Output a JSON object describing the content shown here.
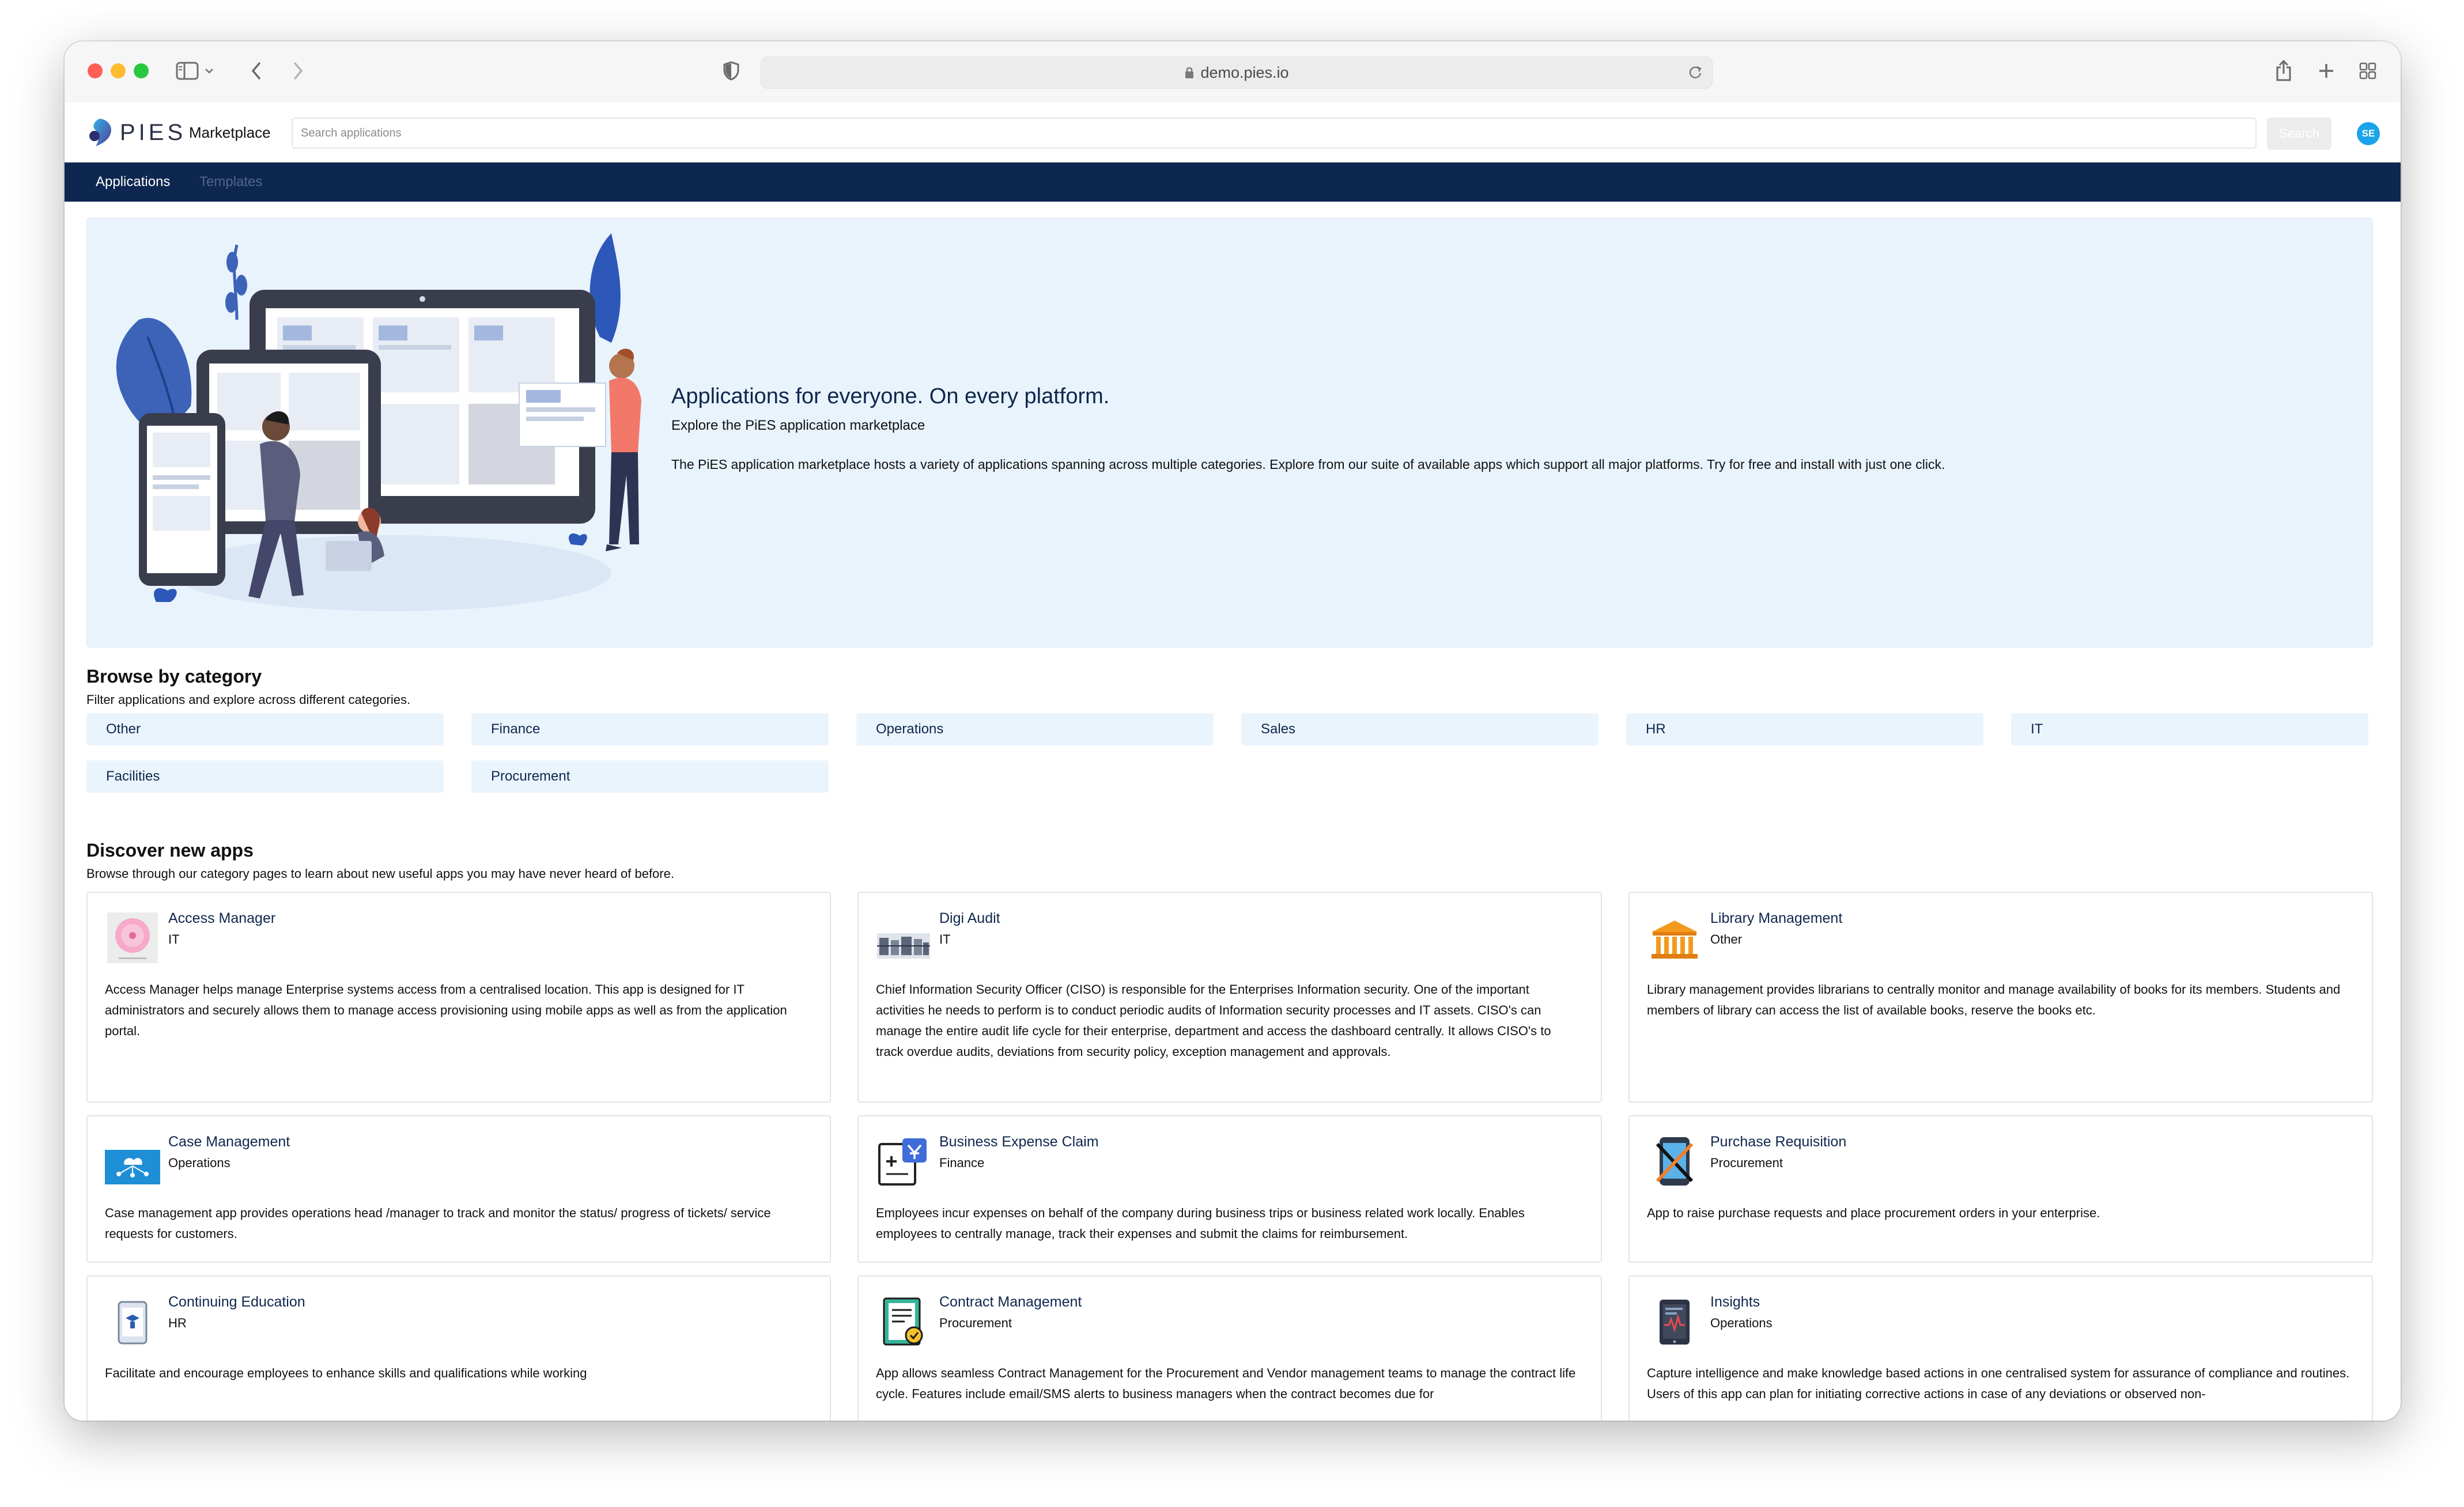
{
  "browser": {
    "url": "demo.pies.io",
    "icons": [
      "sidebar-icon",
      "chevron-down-icon",
      "back-icon",
      "forward-icon",
      "shield-icon",
      "lock-icon",
      "reload-icon",
      "share-icon",
      "new-tab-icon",
      "tab-overview-icon"
    ]
  },
  "header": {
    "logo_text": "PIES",
    "title": "Marketplace",
    "search_placeholder": "Search applications",
    "search_button": "Search",
    "avatar_initials": "SE"
  },
  "nav": {
    "tabs": [
      {
        "label": "Applications",
        "active": true
      },
      {
        "label": "Templates",
        "active": false
      }
    ]
  },
  "hero": {
    "title": "Applications for everyone. On every platform.",
    "subtitle": "Explore the PiES application marketplace",
    "description": "The PiES application marketplace hosts a variety of applications spanning across multiple categories. Explore from our suite of available apps which support all major platforms. Try for free and install with just one click."
  },
  "browse": {
    "title": "Browse by category",
    "subtitle": "Filter applications and explore across different categories.",
    "categories": [
      "Other",
      "Finance",
      "Operations",
      "Sales",
      "HR",
      "IT",
      "Facilities",
      "Procurement"
    ]
  },
  "discover": {
    "title": "Discover new apps",
    "subtitle": "Browse through our category pages to learn about new useful apps you may have never heard of before.",
    "apps": [
      {
        "name": "Access Manager",
        "category": "IT",
        "icon": "access-manager-icon",
        "description": "Access Manager helps manage Enterprise systems access from a centralised location. This app is designed for IT administrators and securely allows them to manage access provisioning using mobile apps as well as from the application portal."
      },
      {
        "name": "Digi Audit",
        "category": "IT",
        "icon": "digi-audit-icon",
        "description": "Chief Information Security Officer (CISO) is responsible for the Enterprises Information security. One of the important activities he needs to perform is to conduct periodic audits of Information security processes and IT assets. CISO's can manage the entire audit life cycle for their enterprise, department and access the dashboard centrally. It allows CISO's to track overdue audits, deviations from security policy, exception management and approvals."
      },
      {
        "name": "Library Management",
        "category": "Other",
        "icon": "library-building-icon",
        "description": "Library management provides librarians to centrally monitor and manage availability of books for its members. Students and members of library can access the list of available books, reserve the books etc."
      },
      {
        "name": "Case Management",
        "category": "Operations",
        "icon": "case-management-icon",
        "description": "Case management app provides operations head /manager to track and monitor the status/ progress of tickets/ service requests for customers."
      },
      {
        "name": "Business Expense Claim",
        "category": "Finance",
        "icon": "expense-claim-icon",
        "description": "Employees incur expenses on behalf of the company during business trips or business related work locally. Enables employees to centrally manage, track their expenses and submit the claims for reimbursement."
      },
      {
        "name": "Purchase Requisition",
        "category": "Procurement",
        "icon": "purchase-requisition-icon",
        "description": "App to raise purchase requests and place procurement orders in your enterprise."
      },
      {
        "name": "Continuing Education",
        "category": "HR",
        "icon": "continuing-education-icon",
        "description": "Facilitate and encourage employees to enhance skills and qualifications while working"
      },
      {
        "name": "Contract Management",
        "category": "Procurement",
        "icon": "contract-document-icon",
        "description": "App allows seamless Contract Management for the Procurement and Vendor management teams to manage the contract life cycle. Features include email/SMS alerts to business managers when the contract becomes due for"
      },
      {
        "name": "Insights",
        "category": "Operations",
        "icon": "insights-tablet-icon",
        "description": "Capture intelligence and make knowledge based actions in one centralised system for assurance of compliance and routines. Users of this app can plan for initiating corrective actions in case of any deviations or observed non-"
      }
    ]
  },
  "colors": {
    "navbar": "#0d2751",
    "hero_bg": "#e9f3fc",
    "category_bg": "#eaf4fd",
    "link_text": "#0f274d",
    "avatar": "#1aa3e8"
  }
}
